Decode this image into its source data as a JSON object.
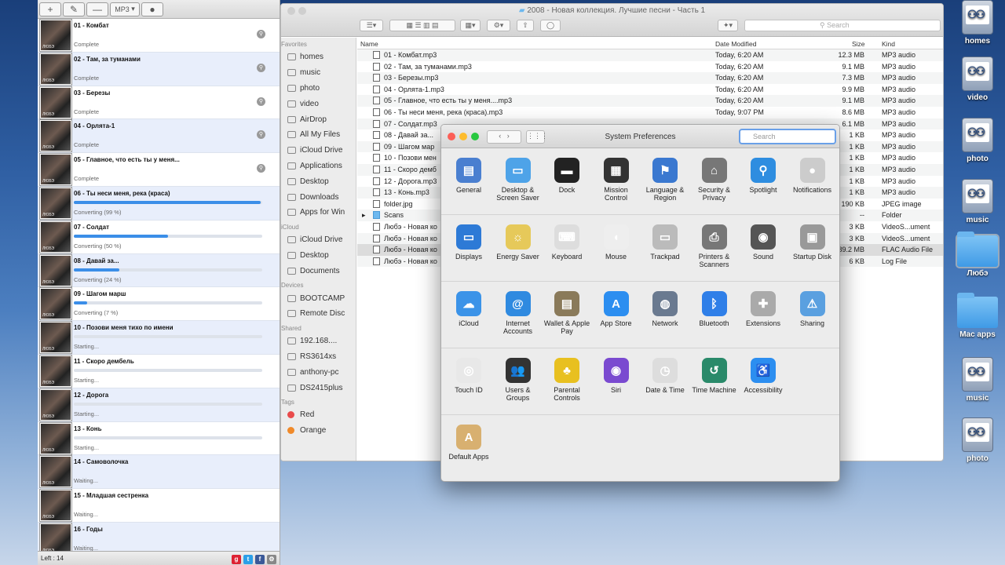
{
  "desktop": {
    "icons": [
      {
        "label": "homes",
        "type": "drive"
      },
      {
        "label": "video",
        "type": "drive"
      },
      {
        "label": "photo",
        "type": "drive"
      },
      {
        "label": "music",
        "type": "drive"
      },
      {
        "label": "Любэ",
        "type": "folder"
      },
      {
        "label": "Mac apps",
        "type": "folder"
      },
      {
        "label": "music",
        "type": "drive"
      },
      {
        "label": "photo",
        "type": "drive"
      }
    ]
  },
  "converter": {
    "format": "MP3",
    "toolbar": {
      "add": "+",
      "remove": "—",
      "record": "●"
    },
    "items": [
      {
        "title": "01 - Комбат",
        "status": "Complete",
        "progress": null
      },
      {
        "title": "02 - Там, за туманами",
        "status": "Complete",
        "progress": null
      },
      {
        "title": "03 - Березы",
        "status": "Complete",
        "progress": null
      },
      {
        "title": "04 - Орлята-1",
        "status": "Complete",
        "progress": null
      },
      {
        "title": "05 - Главное, что есть ты у меня...",
        "status": "Complete",
        "progress": null
      },
      {
        "title": "06 - Ты неси меня, река (краса)",
        "status": "Converting (99 %)",
        "progress": 99
      },
      {
        "title": "07 - Солдат",
        "status": "Converting (50 %)",
        "progress": 50
      },
      {
        "title": "08 - Давай за...",
        "status": "Converting (24 %)",
        "progress": 24
      },
      {
        "title": "09 - Шагом марш",
        "status": "Converting (7 %)",
        "progress": 7
      },
      {
        "title": "10 - Позови меня тихо по имени",
        "status": "Starting...",
        "progress": 0
      },
      {
        "title": "11 - Скоро дембель",
        "status": "Starting...",
        "progress": 0
      },
      {
        "title": "12 - Дорога",
        "status": "Starting...",
        "progress": 0
      },
      {
        "title": "13 - Конь",
        "status": "Starting...",
        "progress": 0
      },
      {
        "title": "14 - Самоволочка",
        "status": "Waiting...",
        "progress": null
      },
      {
        "title": "15 - Младшая сестренка",
        "status": "Waiting...",
        "progress": null
      },
      {
        "title": "16 - Годы",
        "status": "Waiting...",
        "progress": null
      }
    ],
    "footer": "Left : 14"
  },
  "finder": {
    "title": "2008 - Новая коллекция. Лучшие песни - Часть 1",
    "search_placeholder": "Search",
    "columns": {
      "name": "Name",
      "modified": "Date Modified",
      "size": "Size",
      "kind": "Kind"
    },
    "sidebar": [
      {
        "section": "Favorites"
      },
      {
        "label": "homes"
      },
      {
        "label": "music"
      },
      {
        "label": "photo"
      },
      {
        "label": "video"
      },
      {
        "label": "AirDrop"
      },
      {
        "label": "All My Files"
      },
      {
        "label": "iCloud Drive"
      },
      {
        "label": "Applications"
      },
      {
        "label": "Desktop"
      },
      {
        "label": "Downloads"
      },
      {
        "label": "Apps for Win"
      },
      {
        "section": "iCloud"
      },
      {
        "label": "iCloud Drive"
      },
      {
        "label": "Desktop"
      },
      {
        "label": "Documents"
      },
      {
        "section": "Devices"
      },
      {
        "label": "BOOTCAMP"
      },
      {
        "label": "Remote Disc"
      },
      {
        "section": "Shared"
      },
      {
        "label": "192.168...."
      },
      {
        "label": "RS3614xs"
      },
      {
        "label": "anthony-pc"
      },
      {
        "label": "DS2415plus"
      },
      {
        "section": "Tags"
      },
      {
        "label": "Red",
        "tag": "#e94b4b"
      },
      {
        "label": "Orange",
        "tag": "#f08a2a"
      }
    ],
    "files": [
      {
        "name": "01 - Комбат.mp3",
        "modified": "Today, 6:20 AM",
        "size": "12.3 MB",
        "kind": "MP3 audio"
      },
      {
        "name": "02 - Там, за туманами.mp3",
        "modified": "Today, 6:20 AM",
        "size": "9.1 MB",
        "kind": "MP3 audio"
      },
      {
        "name": "03 - Березы.mp3",
        "modified": "Today, 6:20 AM",
        "size": "7.3 MB",
        "kind": "MP3 audio"
      },
      {
        "name": "04 - Орлята-1.mp3",
        "modified": "Today, 6:20 AM",
        "size": "9.9 MB",
        "kind": "MP3 audio"
      },
      {
        "name": "05 - Главное, что есть ты у меня....mp3",
        "modified": "Today, 6:20 AM",
        "size": "9.1 MB",
        "kind": "MP3 audio"
      },
      {
        "name": "06 - Ты неси меня, река (краса).mp3",
        "modified": "Today, 9:07 PM",
        "size": "8.6 MB",
        "kind": "MP3 audio"
      },
      {
        "name": "07 - Солдат.mp3",
        "modified": "",
        "size": "6.1 MB",
        "kind": "MP3 audio"
      },
      {
        "name": "08 - Давай за...",
        "modified": "",
        "size": "1 KB",
        "kind": "MP3 audio"
      },
      {
        "name": "09 - Шагом мар",
        "modified": "",
        "size": "1 KB",
        "kind": "MP3 audio"
      },
      {
        "name": "10 - Позови мен",
        "modified": "",
        "size": "1 KB",
        "kind": "MP3 audio"
      },
      {
        "name": "11 - Скоро демб",
        "modified": "",
        "size": "1 KB",
        "kind": "MP3 audio"
      },
      {
        "name": "12 - Дорога.mp3",
        "modified": "",
        "size": "1 KB",
        "kind": "MP3 audio"
      },
      {
        "name": "13 - Конь.mp3",
        "modified": "",
        "size": "1 KB",
        "kind": "MP3 audio"
      },
      {
        "name": "folder.jpg",
        "modified": "",
        "size": "190 KB",
        "kind": "JPEG image"
      },
      {
        "name": "Scans",
        "modified": "",
        "size": "--",
        "kind": "Folder"
      },
      {
        "name": "Любэ - Новая ко",
        "modified": "",
        "size": "3 KB",
        "kind": "VideoS...ument"
      },
      {
        "name": "Любэ - Новая ко",
        "modified": "",
        "size": "3 KB",
        "kind": "VideoS...ument"
      },
      {
        "name": "Любэ - Новая ко",
        "modified": "",
        "size": "89.2 MB",
        "kind": "FLAC Audio File"
      },
      {
        "name": "Любэ - Новая ко",
        "modified": "",
        "size": "6 KB",
        "kind": "Log File"
      }
    ]
  },
  "sysprefs": {
    "title": "System Preferences",
    "search_placeholder": "Search",
    "rows": [
      [
        {
          "label": "General",
          "color": "#4a7fd0",
          "glyph": "▤"
        },
        {
          "label": "Desktop & Screen Saver",
          "color": "#4ea3e8",
          "glyph": "▭"
        },
        {
          "label": "Dock",
          "color": "#222",
          "glyph": "▬"
        },
        {
          "label": "Mission Control",
          "color": "#333",
          "glyph": "▦"
        },
        {
          "label": "Language & Region",
          "color": "#3a78d0",
          "glyph": "⚑"
        },
        {
          "label": "Security & Privacy",
          "color": "#777",
          "glyph": "⌂"
        },
        {
          "label": "Spotlight",
          "color": "#2e8de0",
          "glyph": "⚲"
        },
        {
          "label": "Notifications",
          "color": "#ccc",
          "glyph": "●"
        }
      ],
      [
        {
          "label": "Displays",
          "color": "#2d7ad6",
          "glyph": "▭"
        },
        {
          "label": "Energy Saver",
          "color": "#e6c95a",
          "glyph": "☼"
        },
        {
          "label": "Keyboard",
          "color": "#ddd",
          "glyph": "⌨"
        },
        {
          "label": "Mouse",
          "color": "#eee",
          "glyph": "◖"
        },
        {
          "label": "Trackpad",
          "color": "#bbb",
          "glyph": "▭"
        },
        {
          "label": "Printers & Scanners",
          "color": "#777",
          "glyph": "⎙"
        },
        {
          "label": "Sound",
          "color": "#555",
          "glyph": "◉"
        },
        {
          "label": "Startup Disk",
          "color": "#999",
          "glyph": "▣"
        }
      ],
      [
        {
          "label": "iCloud",
          "color": "#3b93e8",
          "glyph": "☁"
        },
        {
          "label": "Internet Accounts",
          "color": "#2f8ae0",
          "glyph": "@"
        },
        {
          "label": "Wallet & Apple Pay",
          "color": "#8a7a5a",
          "glyph": "▤"
        },
        {
          "label": "App Store",
          "color": "#2c8ef0",
          "glyph": "A"
        },
        {
          "label": "Network",
          "color": "#6a7a90",
          "glyph": "◍"
        },
        {
          "label": "Bluetooth",
          "color": "#2f7fe8",
          "glyph": "ᛒ"
        },
        {
          "label": "Extensions",
          "color": "#aaa",
          "glyph": "✚"
        },
        {
          "label": "Sharing",
          "color": "#5aa0e0",
          "glyph": "⚠"
        }
      ],
      [
        {
          "label": "Touch ID",
          "color": "#e8e8e8",
          "glyph": "◎"
        },
        {
          "label": "Users & Groups",
          "color": "#333",
          "glyph": "👥"
        },
        {
          "label": "Parental Controls",
          "color": "#e8c020",
          "glyph": "♣"
        },
        {
          "label": "Siri",
          "color": "#7a4ad0",
          "glyph": "◉"
        },
        {
          "label": "Date & Time",
          "color": "#ddd",
          "glyph": "◷"
        },
        {
          "label": "Time Machine",
          "color": "#2a8a6a",
          "glyph": "↺"
        },
        {
          "label": "Accessibility",
          "color": "#2c8ef0",
          "glyph": "♿"
        }
      ],
      [
        {
          "label": "Default Apps",
          "color": "#d8b070",
          "glyph": "A"
        }
      ]
    ]
  }
}
